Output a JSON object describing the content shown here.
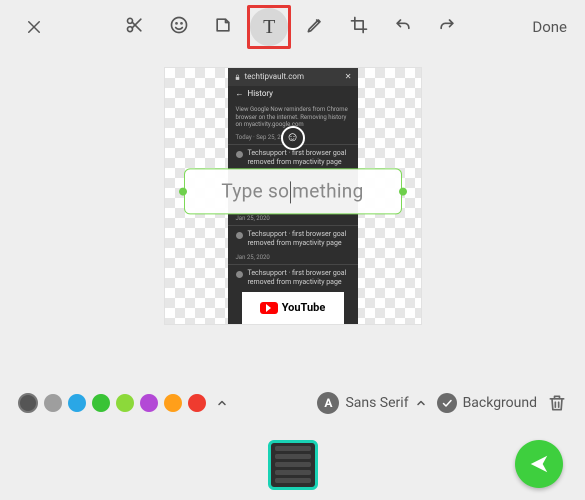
{
  "toolbar": {
    "done_label": "Done"
  },
  "canvas": {
    "phone": {
      "site": "techtipvault.com",
      "section": "History",
      "blurb": "View Google Now reminders from Chrome browser on the internet. Removing history on myactivity.google.com",
      "today": "Today · Sep 25, 2020",
      "row1": "Techsupport · first browser goal removed from myactivity page",
      "date2": "Jan 25, 2020",
      "row2": "Techsupport · first browser goal removed from myactivity page",
      "youtube": "YouTube"
    },
    "text_placeholder_left": "Type so",
    "text_placeholder_right": "mething"
  },
  "text_toolbar": {
    "colors": [
      {
        "hex": "#555555",
        "selected": true
      },
      {
        "hex": "#9e9e9e",
        "selected": false
      },
      {
        "hex": "#2aa7e6",
        "selected": false
      },
      {
        "hex": "#39c336",
        "selected": false
      },
      {
        "hex": "#8cd93a",
        "selected": false
      },
      {
        "hex": "#b349d6",
        "selected": false
      },
      {
        "hex": "#ff9f1a",
        "selected": false
      },
      {
        "hex": "#ef3b2f",
        "selected": false
      }
    ],
    "font_icon_letter": "A",
    "font_label": "Sans Serif",
    "background_label": "Background"
  }
}
